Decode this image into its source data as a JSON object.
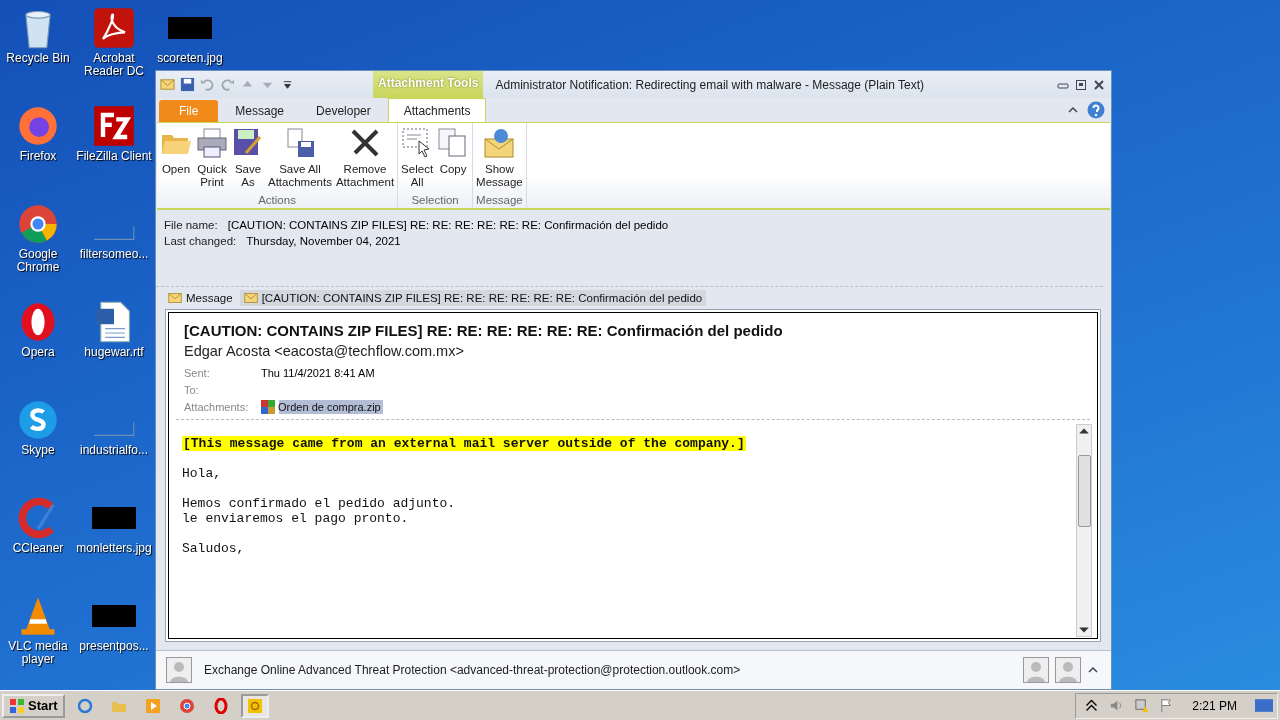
{
  "desktop": {
    "icons": [
      {
        "label": "Recycle Bin",
        "kind": "trash"
      },
      {
        "label": "Firefox",
        "kind": "firefox"
      },
      {
        "label": "Google Chrome",
        "kind": "chrome"
      },
      {
        "label": "Opera",
        "kind": "opera"
      },
      {
        "label": "Skype",
        "kind": "skype"
      },
      {
        "label": "CCleaner",
        "kind": "ccleaner"
      },
      {
        "label": "VLC media player",
        "kind": "vlc"
      },
      {
        "label": "Acrobat Reader DC",
        "kind": "acrobat"
      },
      {
        "label": "FileZilla Client",
        "kind": "filezilla"
      },
      {
        "label": "filtersomeo...",
        "kind": "blank"
      },
      {
        "label": "hugewar.rtf",
        "kind": "word"
      },
      {
        "label": "industrialfo...",
        "kind": "blank"
      },
      {
        "label": "monletters.jpg",
        "kind": "image"
      },
      {
        "label": "presentpos...",
        "kind": "image"
      },
      {
        "label": "scoreten.jpg",
        "kind": "image"
      }
    ]
  },
  "window": {
    "context_tab": "Attachment Tools",
    "title": "Administrator Notification: Redirecting email with malware  -  Message (Plain Text)",
    "tabs": [
      {
        "label": "File",
        "kind": "file",
        "selected": false
      },
      {
        "label": "Message",
        "kind": "normal",
        "selected": false
      },
      {
        "label": "Developer",
        "kind": "normal",
        "selected": false
      },
      {
        "label": "Attachments",
        "kind": "normal",
        "selected": true
      }
    ],
    "ribbon": [
      {
        "group": "Actions",
        "buttons": [
          {
            "kind": "open",
            "lines": [
              "Open"
            ]
          },
          {
            "kind": "print",
            "lines": [
              "Quick",
              "Print"
            ]
          },
          {
            "kind": "saveas",
            "lines": [
              "Save",
              "As"
            ]
          },
          {
            "kind": "saveall",
            "lines": [
              "Save All",
              "Attachments"
            ]
          },
          {
            "kind": "remove",
            "lines": [
              "Remove",
              "Attachment"
            ]
          }
        ]
      },
      {
        "group": "Selection",
        "buttons": [
          {
            "kind": "select",
            "lines": [
              "Select",
              "All"
            ]
          },
          {
            "kind": "copy",
            "lines": [
              "Copy"
            ]
          }
        ]
      },
      {
        "group": "Message",
        "buttons": [
          {
            "kind": "show",
            "lines": [
              "Show",
              "Message"
            ]
          }
        ]
      }
    ]
  },
  "file_info": [
    {
      "label": "File name:",
      "value": "[CAUTION: CONTAINS ZIP FILES] RE: RE: RE: RE: RE: RE:  Confirmación del pedido"
    },
    {
      "label": "Last changed:",
      "value": "Thursday, November 04, 2021"
    }
  ],
  "message_tabs": [
    {
      "label": "Message",
      "selected": false
    },
    {
      "label": "[CAUTION: CONTAINS ZIP FILES] RE: RE: RE: RE: RE: RE:  Confirmación del pedido",
      "selected": true
    }
  ],
  "preview": {
    "subject": "[CAUTION: CONTAINS ZIP FILES] RE: RE: RE: RE: RE: RE:  Confirmación del pedido",
    "from": "Edgar Acosta <eacosta@techflow.com.mx>",
    "fields": [
      {
        "label": "Sent:",
        "value": "Thu 11/4/2021 8:41 AM"
      },
      {
        "label": "To:"
      },
      {
        "label": "Attachments:",
        "attachment": {
          "name": "Orden de compra.zip",
          "selected": true
        }
      }
    ],
    "body": [
      {
        "kind": "banner",
        "lines": [
          "[This message came from an external mail server outside of the company.]"
        ]
      },
      {
        "kind": "text",
        "lines": [
          "Hola,"
        ]
      },
      {
        "kind": "text",
        "lines": [
          "Hemos confirmado el pedido adjunto.",
          "le enviaremos el pago pronto."
        ]
      },
      {
        "kind": "text",
        "lines": [
          "Saludos,"
        ]
      }
    ]
  },
  "people_pane": {
    "sender": "Exchange Online Advanced Threat Protection <advanced-threat-protection@protection.outlook.com>"
  },
  "taskbar": {
    "start": "Start",
    "apps": [
      {
        "kind": "ie",
        "selected": false
      },
      {
        "kind": "folder",
        "selected": false
      },
      {
        "kind": "media",
        "selected": false
      },
      {
        "kind": "chrome",
        "selected": false
      },
      {
        "kind": "opera",
        "selected": false
      },
      {
        "kind": "outlook",
        "selected": true
      }
    ],
    "time": "2:21 PM"
  }
}
